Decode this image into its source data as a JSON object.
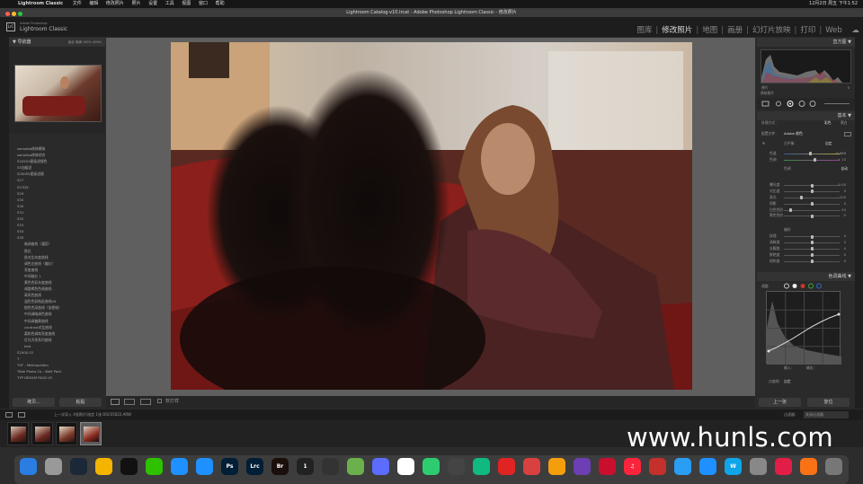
{
  "menubar": {
    "app": "Lightroom Classic",
    "items": [
      "文件",
      "编辑",
      "修改照片",
      "照片",
      "设置",
      "工具",
      "视图",
      "窗口",
      "帮助"
    ],
    "right": "12月2日 周五 下午1:52"
  },
  "window": {
    "title": "Lightroom Catalog-v10.lrcat - Adobe Photoshop Lightroom Classic - 修改照片"
  },
  "brand": {
    "small": "Adobe Photoshop",
    "big": "Lightroom Classic"
  },
  "modules": [
    "图库",
    "修改照片",
    "地图",
    "画册",
    "幻灯片放映",
    "打印",
    "Web"
  ],
  "left": {
    "navigator": "导航器",
    "zoom": [
      "适合",
      "填满",
      "100%",
      "400%"
    ],
    "folders": [
      "samolba修体模拟",
      "samolba修体综合",
      "S20503星级滤镜色",
      "S5加级滤",
      "S2S0S5星级滤镜",
      "S27",
      "S27DX",
      "S29",
      "S30",
      "S30",
      "S31",
      "S32",
      "S33",
      "S34",
      "S35",
      "暗调曲线（通用）",
      "肤比",
      "肌对比灰度曲线",
      "调色左曲线（偏红）",
      "亮度曲线",
      "中间暗红 1",
      "黄色色彩灰度曲线",
      "调整褐色色调曲线",
      "高亮色曲线",
      "温色色彩拖延曲线09",
      "橙色色深曲线（加更暗）",
      "中间调暗调色曲线",
      "中间调偏黄曲线",
      "contrast对比曲线",
      "柔和色调商亮度曲线",
      "灯光冷亮系列曲线",
      "test",
      "S2500 02",
      "T",
      "TVF - Metropolitan",
      "Tribe Photo Co - Wolf Pack",
      "TYP DREAM PACK LR"
    ],
    "buttons": {
      "copy": "拷贝...",
      "paste": "粘贴"
    }
  },
  "right": {
    "histogram": "直方图",
    "hist_labels": {
      "left": "原片",
      "right": "0"
    },
    "original": "原始照片",
    "basic": "基本",
    "treatment": {
      "label": "处理方式：",
      "color": "彩色",
      "bw": "黑白"
    },
    "profile": {
      "label": "配置文件：",
      "value": "Adobe 颜色"
    },
    "wb": {
      "label": "白平衡：",
      "value": "自定"
    },
    "temp": {
      "label": "色温",
      "value": "5,686"
    },
    "tint": {
      "label": "色调",
      "value": "+ 10"
    },
    "tone": {
      "label": "色调",
      "auto": "自动"
    },
    "sliders": [
      {
        "label": "曝光度",
        "value": "0.00"
      },
      {
        "label": "对比度",
        "value": "0"
      },
      {
        "label": "高光",
        "value": "- 100"
      },
      {
        "label": "阴影",
        "value": "0"
      },
      {
        "label": "白色色阶",
        "value": "- 44"
      },
      {
        "label": "黑色色阶",
        "value": "0"
      }
    ],
    "presence": "偏好",
    "sliders2": [
      {
        "label": "纹理",
        "value": "0"
      },
      {
        "label": "清晰度",
        "value": "0"
      },
      {
        "label": "去朦胧",
        "value": "0"
      },
      {
        "label": "鲜艳度",
        "value": "0"
      },
      {
        "label": "饱和度",
        "value": "0"
      }
    ],
    "tone_curve": "色调曲线",
    "channel": "调整：",
    "point_curve": {
      "label": "点曲线：",
      "value": "自定"
    },
    "curve_labels": {
      "in": "输入：",
      "out": "输出："
    },
    "buttons": {
      "prev": "上一张",
      "reset": "复位"
    }
  },
  "toolbar": {
    "label": "软打样"
  },
  "filmstrip_bar": {
    "info": "上一次导入  4张照片/选定 1张  DSC05022.ARW",
    "filter": "过滤器：",
    "filter_value": "关闭过滤器"
  },
  "watermark": "www.hunls.com",
  "dock_icons": [
    "finder-icon",
    "launchpad-icon",
    "steam-icon",
    "chrome-icon",
    "qq-icon",
    "wechat-icon",
    "appstore-icon",
    "safari-icon",
    "photoshop-icon",
    "lightroom-icon",
    "bridge-icon",
    "one-icon",
    "obs-icon",
    "pixelmator-icon",
    "vtuber-icon",
    "photos-icon",
    "clips-icon",
    "finalcut-icon",
    "qiyi-icon",
    "record-icon",
    "radio-icon",
    "keynote-icon",
    "prisma-icon",
    "netease-icon",
    "music-icon",
    "youtube-icon",
    "maps-icon",
    "testflight-icon",
    "w-icon",
    "settings-icon",
    "adobe-icon",
    "lines-icon",
    "trash-icon"
  ]
}
